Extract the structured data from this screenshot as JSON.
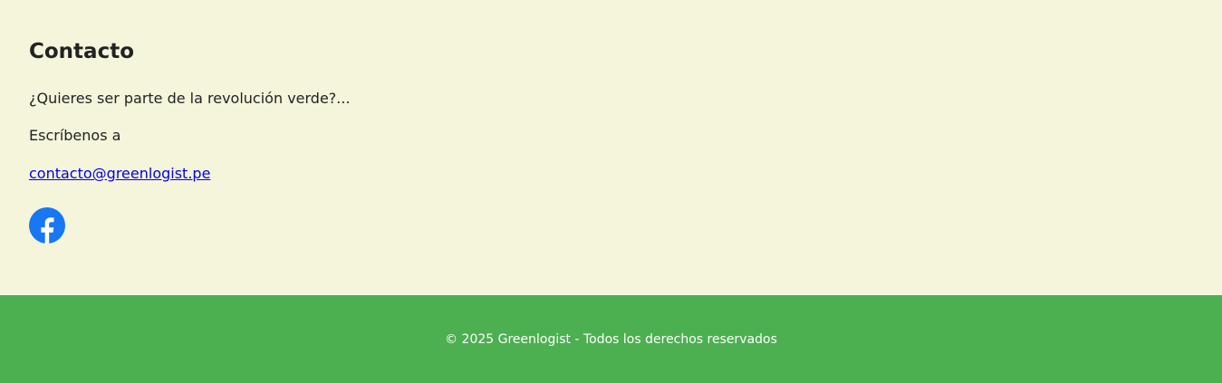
{
  "colors": {
    "background": "#f5f5dc",
    "footer_background": "#4caf50",
    "heading": "#222222",
    "text": "#222222",
    "link": "#0000ee",
    "facebook": "#1877f2",
    "footer_text": "#ffffff"
  },
  "contact": {
    "title": "Contacto",
    "line_1": "¿Quieres ser parte de la revolución verde?...",
    "line_2": "Escríbenos a",
    "email": "contacto@greenlogist.pe"
  },
  "social": {
    "icon": "facebook-icon"
  },
  "footer": {
    "copyright": "© 2025 Greenlogist - Todos los derechos reservados"
  }
}
